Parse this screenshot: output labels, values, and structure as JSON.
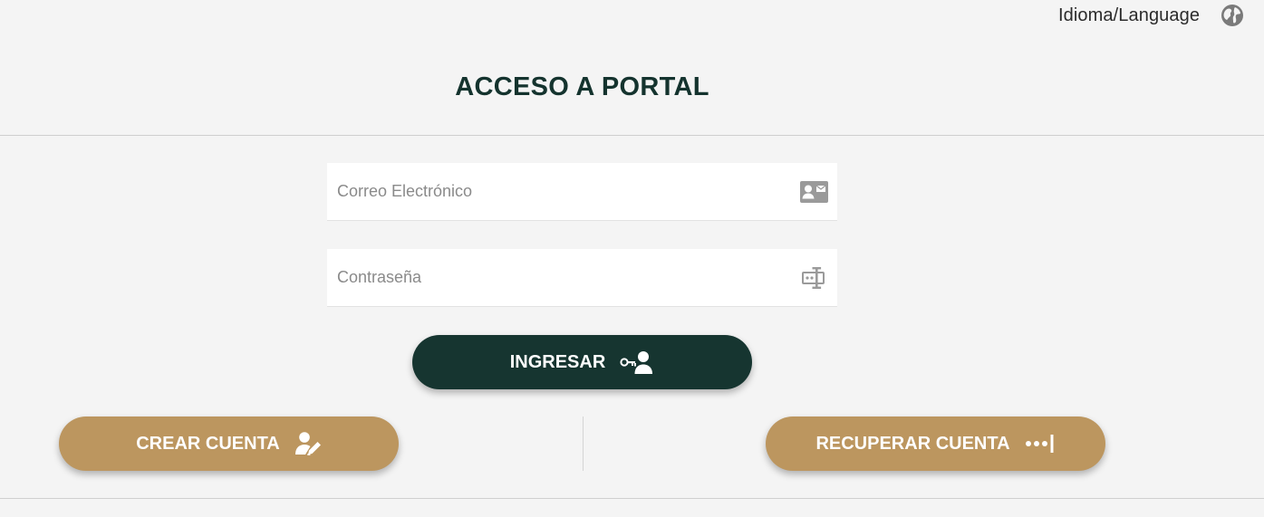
{
  "header": {
    "language_label": "Idioma/Language",
    "language_icon": "globe-icon"
  },
  "title": "ACCESO A PORTAL",
  "form": {
    "email": {
      "value": "",
      "placeholder": "Correo Electrónico",
      "icon": "contact-mail-icon"
    },
    "password": {
      "value": "",
      "placeholder": "Contraseña",
      "icon": "password-field-icon"
    }
  },
  "buttons": {
    "login": {
      "label": "INGRESAR",
      "icon": "key-user-icon"
    },
    "create_account": {
      "label": "CREAR CUENTA",
      "icon": "user-edit-icon"
    },
    "recover_account": {
      "label": "RECUPERAR CUENTA",
      "icon": "password-dots-icon"
    }
  },
  "colors": {
    "background": "#f4f4f4",
    "primary": "#163530",
    "gold": "#bc965f",
    "title": "#14332e",
    "icon_gray": "#9a9a9a"
  }
}
